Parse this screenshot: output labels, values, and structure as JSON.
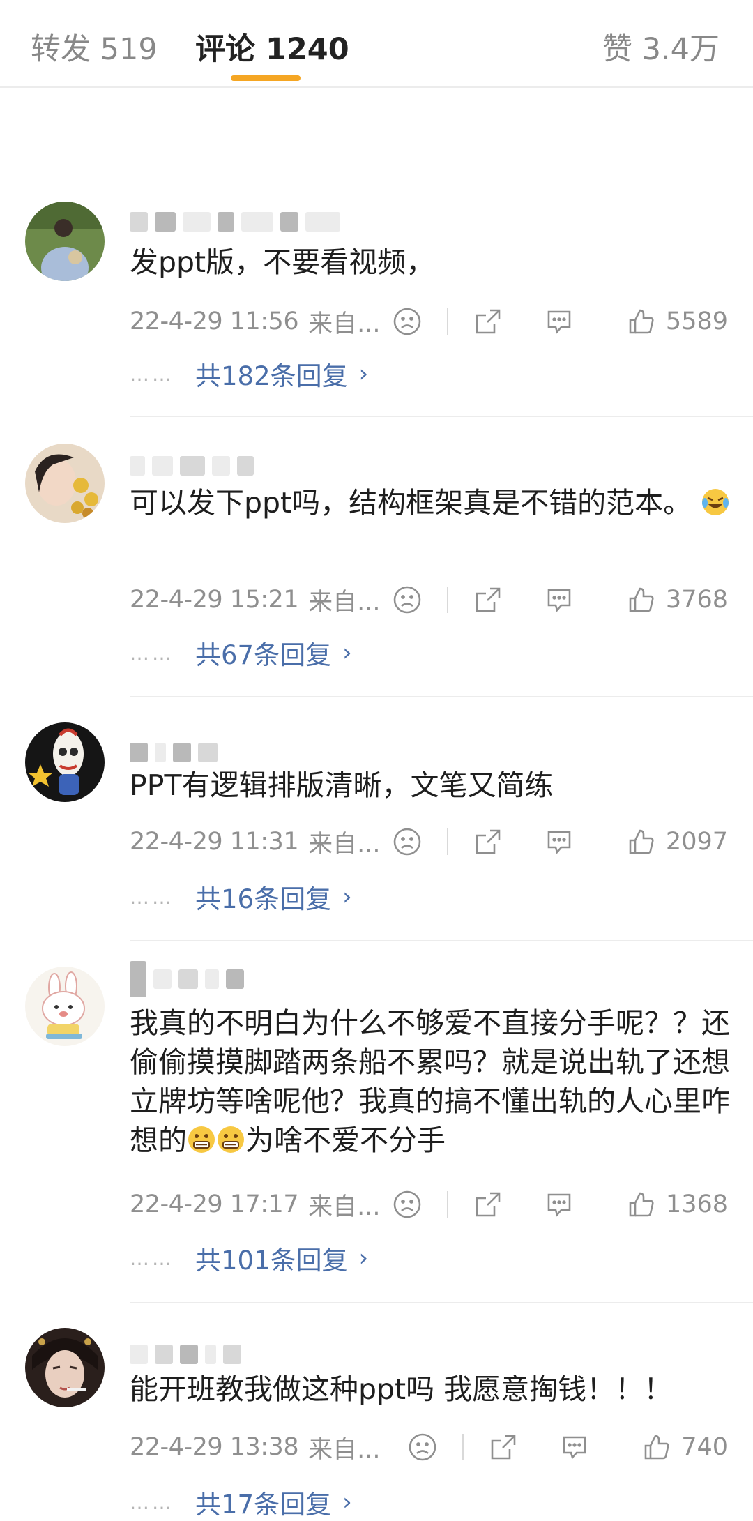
{
  "tabs": {
    "repost": "转发 519",
    "comments": "评论 1240",
    "likes": "赞 3.4万"
  },
  "comments": [
    {
      "text": "发ppt版，不要看视频，",
      "time": "22-4-29 11:56",
      "source": "来自...",
      "likes": "5589",
      "replies": "共182条回复"
    },
    {
      "text": "可以发下ppt吗，结构框架真是不错的范本。",
      "time": "22-4-29 15:21",
      "source": "来自...",
      "likes": "3768",
      "replies": "共67条回复"
    },
    {
      "text": "PPT有逻辑排版清晰，文笔又简练",
      "time": "22-4-29 11:31",
      "source": "来自...",
      "likes": "2097",
      "replies": "共16条回复"
    },
    {
      "text_before_emoji": "我真的不明白为什么不够爱不直接分手呢？？还偷偷摸摸脚踏两条船不累吗？就是说出轨了还想立牌坊等啥呢他？我真的搞不懂出轨的人心里咋想的",
      "text_after_emoji": "为啥不爱不分手",
      "time": "22-4-29 17:17",
      "source": "来自...",
      "likes": "1368",
      "replies": "共101条回复"
    },
    {
      "text": "能开班教我做这种ppt吗 我愿意掏钱！！！",
      "time": "22-4-29 13:38",
      "source": "来自...",
      "likes": "740",
      "replies": "共17条回复"
    }
  ],
  "icons": {
    "dislike": "sad-face-icon",
    "share": "share-icon",
    "reply": "chat-bubble-icon",
    "like": "thumbs-up-icon",
    "more_replies": "chevron-right-icon"
  },
  "colors": {
    "accent": "#f5a623",
    "link": "#4a6ea9",
    "meta": "#8f8f8f"
  },
  "reply_dots": "……",
  "reply_chevron": "›"
}
